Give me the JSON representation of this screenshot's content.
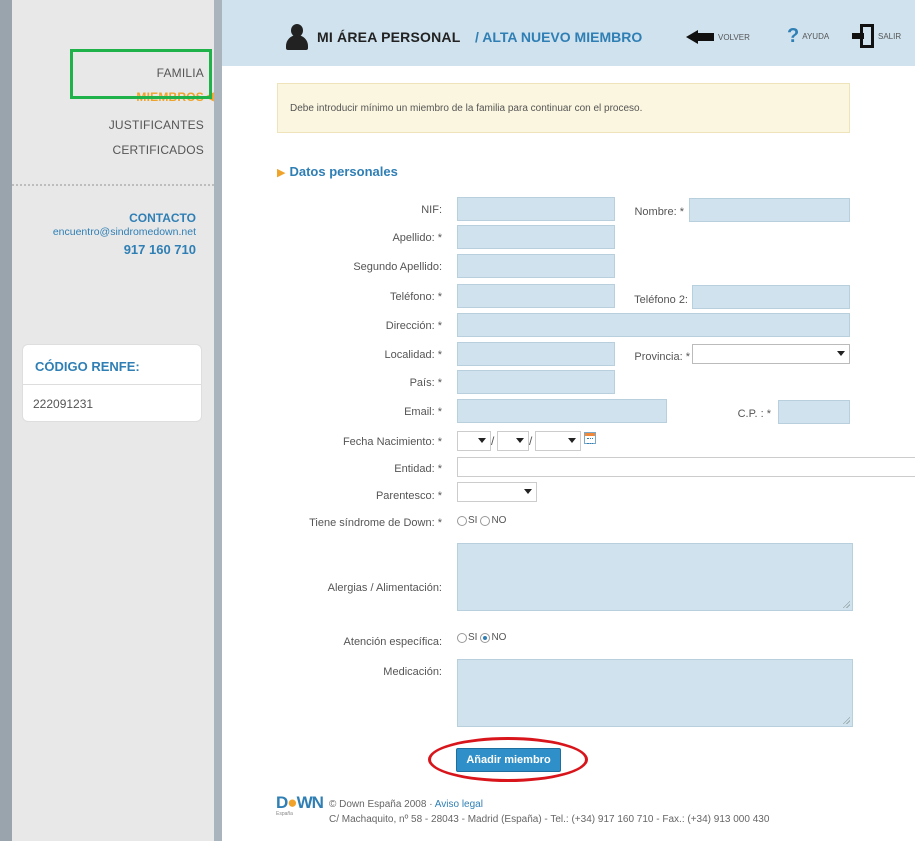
{
  "sidebar": {
    "nav": {
      "familia": "FAMILIA",
      "miembros": "MIEMBROS",
      "justificantes": "JUSTIFICANTES",
      "certificados": "CERTIFICADOS"
    },
    "contact": {
      "title": "CONTACTO",
      "email": "encuentro@sindromedown.net",
      "phone": "917 160 710"
    },
    "renfe": {
      "title": "CÓDIGO RENFE:",
      "value": "222091231"
    }
  },
  "header": {
    "title": "MI ÁREA PERSONAL",
    "subtitle": "/ ALTA NUEVO MIEMBRO",
    "back_label": "VOLVER",
    "help_label": "AYUDA",
    "exit_label": "SALIR",
    "icons": [
      "user-icon",
      "back-arrow-icon",
      "help-icon",
      "exit-door-icon"
    ]
  },
  "notice": "Debe introducir mínimo un miembro de la familia para continuar con el proceso.",
  "section_title": "Datos personales",
  "form": {
    "labels": {
      "nif": "NIF:",
      "nombre": "Nombre: *",
      "apellido": "Apellido: *",
      "segundo_apellido": "Segundo Apellido:",
      "telefono": "Teléfono: *",
      "telefono2": "Teléfono 2:",
      "direccion": "Dirección: *",
      "localidad": "Localidad: *",
      "provincia": "Provincia: *",
      "pais": "País: *",
      "email": "Email: *",
      "cp": "C.P. : *",
      "fecha_nacimiento": "Fecha Nacimiento: *",
      "entidad": "Entidad: *",
      "parentesco": "Parentesco: *",
      "sindrome": "Tiene síndrome de Down: *",
      "alergias": "Alergias / Alimentación:",
      "atencion": "Atención específica:",
      "medicacion": "Medicación:"
    },
    "date_separator": "/",
    "radio": {
      "si": "SI",
      "no": "NO",
      "sindrome_selected": null,
      "atencion_selected": "NO"
    },
    "submit_label": "Añadir miembro"
  },
  "footer": {
    "logo_text": "DOWN",
    "logo_sub": "España",
    "copyright": "© Down España 2008 · ",
    "legal_link": "Aviso legal",
    "address": "C/ Machaquito, nº 58 - 28043 - Madrid (España) - Tel.: (+34) 917 160 710 - Fax.: (+34) 913 000 430"
  },
  "colors": {
    "accent_blue": "#2f7fb5",
    "accent_orange": "#f0a32a",
    "field_bg": "#cfe2ee",
    "highlight_green": "#1fb14a",
    "highlight_red": "#d9151c"
  }
}
